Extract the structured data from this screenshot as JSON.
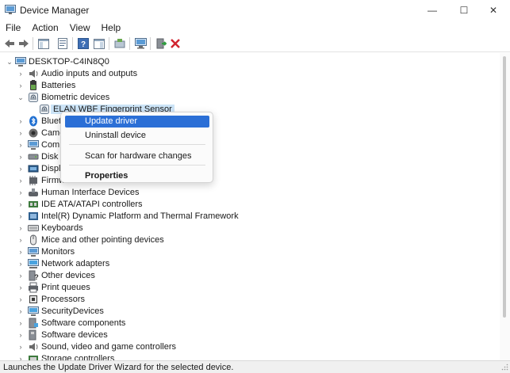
{
  "window": {
    "title": "Device Manager",
    "minimize_glyph": "—",
    "maximize_glyph": "☐",
    "close_glyph": "✕"
  },
  "menubar": {
    "items": [
      "File",
      "Action",
      "View",
      "Help"
    ]
  },
  "toolbar": {
    "buttons": [
      "back-icon",
      "forward-icon",
      "show-hide-console-tree-icon",
      "properties-icon",
      "help-icon",
      "action-pane-icon",
      "update-driver-icon",
      "scan-hardware-icon",
      "enable-device-icon",
      "uninstall-device-icon"
    ],
    "uninstall_color": "#d1242f"
  },
  "tree": {
    "root": "DESKTOP-C4IN8Q0",
    "categories": [
      {
        "label": "Audio inputs and outputs",
        "icon": "speaker-icon"
      },
      {
        "label": "Batteries",
        "icon": "battery-icon"
      },
      {
        "label": "Biometric devices",
        "icon": "fingerprint-icon",
        "expanded": true
      },
      {
        "label": "Bluet",
        "icon": "bluetooth-icon"
      },
      {
        "label": "Came",
        "icon": "camera-icon"
      },
      {
        "label": "Comp",
        "icon": "monitor-icon"
      },
      {
        "label": "Disk d",
        "icon": "disk-icon"
      },
      {
        "label": "Displa",
        "icon": "display-adapter-icon"
      },
      {
        "label": "Firmw",
        "icon": "firmware-icon"
      },
      {
        "label": "Human Interface Devices",
        "icon": "hid-icon"
      },
      {
        "label": "IDE ATA/ATAPI controllers",
        "icon": "ide-icon"
      },
      {
        "label": "Intel(R) Dynamic Platform and Thermal Framework",
        "icon": "intel-icon"
      },
      {
        "label": "Keyboards",
        "icon": "keyboard-icon"
      },
      {
        "label": "Mice and other pointing devices",
        "icon": "mouse-icon"
      },
      {
        "label": "Monitors",
        "icon": "monitor-icon"
      },
      {
        "label": "Network adapters",
        "icon": "network-icon"
      },
      {
        "label": "Other devices",
        "icon": "other-device-icon"
      },
      {
        "label": "Print queues",
        "icon": "printer-icon"
      },
      {
        "label": "Processors",
        "icon": "processor-icon"
      },
      {
        "label": "SecurityDevices",
        "icon": "security-icon"
      },
      {
        "label": "Software components",
        "icon": "software-component-icon"
      },
      {
        "label": "Software devices",
        "icon": "software-device-icon"
      },
      {
        "label": "Sound, video and game controllers",
        "icon": "sound-icon"
      },
      {
        "label": "Storage controllers",
        "icon": "storage-icon"
      }
    ],
    "child_device": "ELAN WBF Fingerprint Sensor"
  },
  "context_menu": {
    "update_driver": "Update driver",
    "uninstall_device": "Uninstall device",
    "scan_hardware": "Scan for hardware changes",
    "properties": "Properties",
    "highlight_color": "#2b6fd6"
  },
  "statusbar": {
    "text": "Launches the Update Driver Wizard for the selected device."
  }
}
